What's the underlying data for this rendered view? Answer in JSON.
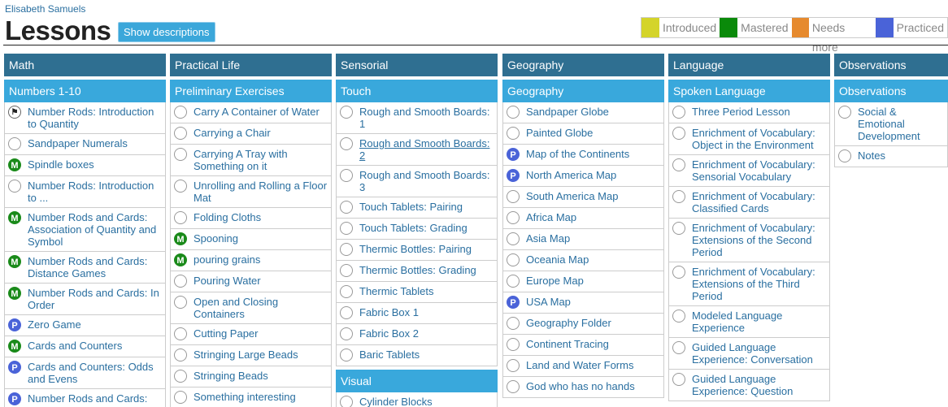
{
  "header": {
    "student_name": "Elisabeth Samuels",
    "title": "Lessons",
    "show_descriptions": "Show descriptions"
  },
  "legend": [
    {
      "label": "Introduced",
      "color": "#d4d42a"
    },
    {
      "label": "Mastered",
      "color": "#0a8a0a"
    },
    {
      "label": "Needs more",
      "color": "#e68a2e"
    },
    {
      "label": "Practiced",
      "color": "#4a63d8"
    }
  ],
  "status_letters": {
    "mastered": "M",
    "practiced": "P",
    "flag": "⚑"
  },
  "areas": [
    {
      "name": "Math",
      "sections": [
        {
          "name": "Numbers 1-10",
          "items": [
            {
              "label": "Number Rods: Introduction to Quantity",
              "status": "flag"
            },
            {
              "label": "Sandpaper Numerals",
              "status": "none"
            },
            {
              "label": "Spindle boxes",
              "status": "mastered"
            },
            {
              "label": "Number Rods: Introduction to ...",
              "status": "none"
            },
            {
              "label": "Number Rods and Cards: Association of Quantity and Symbol",
              "status": "mastered"
            },
            {
              "label": "Number Rods and Cards: Distance Games",
              "status": "mastered"
            },
            {
              "label": "Number Rods and Cards: In Order",
              "status": "mastered"
            },
            {
              "label": "Zero Game",
              "status": "practiced"
            },
            {
              "label": "Cards and Counters",
              "status": "mastered"
            },
            {
              "label": "Cards and Counters: Odds and Evens",
              "status": "practiced"
            },
            {
              "label": "Number Rods and Cards:",
              "status": "practiced"
            }
          ]
        }
      ]
    },
    {
      "name": "Practical Life",
      "sections": [
        {
          "name": "Preliminary Exercises",
          "items": [
            {
              "label": "Carry A Container of Water",
              "status": "none"
            },
            {
              "label": "Carrying a Chair",
              "status": "none"
            },
            {
              "label": "Carrying A Tray with Something on it",
              "status": "none"
            },
            {
              "label": "Unrolling and Rolling a Floor Mat",
              "status": "none"
            },
            {
              "label": "Folding Cloths",
              "status": "none"
            },
            {
              "label": "Spooning",
              "status": "mastered"
            },
            {
              "label": "pouring grains",
              "status": "mastered"
            },
            {
              "label": "Pouring Water",
              "status": "none"
            },
            {
              "label": "Open and Closing Containers",
              "status": "none"
            },
            {
              "label": "Cutting Paper",
              "status": "none"
            },
            {
              "label": "Stringing Large Beads",
              "status": "none"
            },
            {
              "label": "Stringing Beads",
              "status": "none"
            },
            {
              "label": "Something interesting",
              "status": "none"
            }
          ]
        }
      ]
    },
    {
      "name": "Sensorial",
      "sections": [
        {
          "name": "Touch",
          "items": [
            {
              "label": "Rough and Smooth Boards: 1",
              "status": "none"
            },
            {
              "label": "Rough and Smooth Boards: 2",
              "status": "none",
              "underline": true
            },
            {
              "label": "Rough and Smooth Boards: 3",
              "status": "none"
            },
            {
              "label": "Touch Tablets: Pairing",
              "status": "none"
            },
            {
              "label": "Touch Tablets: Grading",
              "status": "none"
            },
            {
              "label": "Thermic Bottles: Pairing",
              "status": "none"
            },
            {
              "label": "Thermic Bottles: Grading",
              "status": "none"
            },
            {
              "label": "Thermic Tablets",
              "status": "none"
            },
            {
              "label": "Fabric Box 1",
              "status": "none"
            },
            {
              "label": "Fabric Box 2",
              "status": "none"
            },
            {
              "label": "Baric Tablets",
              "status": "none"
            }
          ]
        },
        {
          "name": "Visual",
          "items": [
            {
              "label": "Cylinder Blocks",
              "status": "none"
            }
          ]
        }
      ]
    },
    {
      "name": "Geography",
      "sections": [
        {
          "name": "Geography",
          "items": [
            {
              "label": "Sandpaper Globe",
              "status": "none"
            },
            {
              "label": "Painted Globe",
              "status": "none"
            },
            {
              "label": "Map of the Continents",
              "status": "practiced"
            },
            {
              "label": "North America Map",
              "status": "practiced"
            },
            {
              "label": "South America Map",
              "status": "none"
            },
            {
              "label": "Africa Map",
              "status": "none"
            },
            {
              "label": "Asia Map",
              "status": "none"
            },
            {
              "label": "Oceania Map",
              "status": "none"
            },
            {
              "label": "Europe Map",
              "status": "none"
            },
            {
              "label": "USA Map",
              "status": "practiced"
            },
            {
              "label": "Geography Folder",
              "status": "none"
            },
            {
              "label": "Continent Tracing",
              "status": "none"
            },
            {
              "label": "Land and Water Forms",
              "status": "none"
            },
            {
              "label": "God who has no hands",
              "status": "none"
            }
          ]
        }
      ]
    },
    {
      "name": "Language",
      "sections": [
        {
          "name": "Spoken Language",
          "items": [
            {
              "label": "Three Period Lesson",
              "status": "none"
            },
            {
              "label": "Enrichment of Vocabulary: Object in the Environment",
              "status": "none"
            },
            {
              "label": "Enrichment of Vocabulary: Sensorial Vocabulary",
              "status": "none"
            },
            {
              "label": "Enrichment of Vocabulary: Classified Cards",
              "status": "none"
            },
            {
              "label": "Enrichment of Vocabulary: Extensions of the Second Period",
              "status": "none"
            },
            {
              "label": "Enrichment of Vocabulary: Extensions of the Third Period",
              "status": "none"
            },
            {
              "label": "Modeled Language Experience",
              "status": "none"
            },
            {
              "label": "Guided Language Experience: Conversation",
              "status": "none"
            },
            {
              "label": "Guided Language Experience: Question",
              "status": "none"
            }
          ]
        }
      ]
    },
    {
      "name": "Observations",
      "sections": [
        {
          "name": "Observations",
          "items": [
            {
              "label": "Social & Emotional Development",
              "status": "none"
            },
            {
              "label": "Notes",
              "status": "none"
            }
          ]
        }
      ]
    }
  ]
}
